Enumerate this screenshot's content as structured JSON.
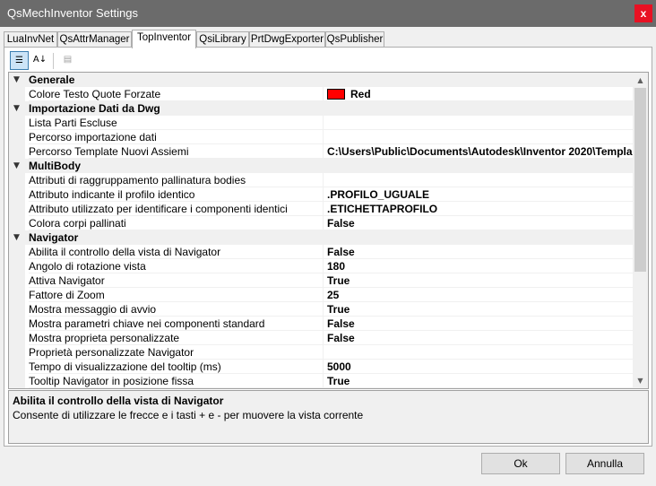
{
  "window": {
    "title": "QsMechInventor Settings",
    "close_label": "x"
  },
  "tabs": [
    {
      "label": "LuaInvNet"
    },
    {
      "label": "QsAttrManager"
    },
    {
      "label": "TopInventor"
    },
    {
      "label": "QsiLibrary"
    },
    {
      "label": "PrtDwgExporter"
    },
    {
      "label": "QsPublisher"
    }
  ],
  "active_tab": "TopInventor",
  "toolbar": {
    "categorized_icon": "categorized-icon",
    "alphabetical_icon": "alphabetical-icon",
    "property_pages_icon": "property-pages-icon"
  },
  "grid": {
    "categories": [
      {
        "label": "Generale",
        "rows": [
          {
            "name": "Colore Testo Quote Forzate",
            "value": "Red",
            "swatch_color": "#ff0000"
          }
        ]
      },
      {
        "label": "Importazione Dati da Dwg",
        "rows": [
          {
            "name": "Lista Parti Escluse",
            "value": ""
          },
          {
            "name": "Percorso importazione dati",
            "value": ""
          },
          {
            "name": "Percorso Template Nuovi Assiemi",
            "value": "C:\\Users\\Public\\Documents\\Autodesk\\Inventor 2020\\Templa"
          }
        ]
      },
      {
        "label": "MultiBody",
        "rows": [
          {
            "name": "Attributi di raggruppamento pallinatura bodies",
            "value": ""
          },
          {
            "name": "Attributo indicante il profilo identico",
            "value": ".PROFILO_UGUALE"
          },
          {
            "name": "Attributo utilizzato per identificare i componenti identici",
            "value": ".ETICHETTAPROFILO"
          },
          {
            "name": "Colora corpi pallinati",
            "value": "False"
          }
        ]
      },
      {
        "label": "Navigator",
        "rows": [
          {
            "name": "Abilita il controllo della vista di Navigator",
            "value": "False"
          },
          {
            "name": "Angolo di rotazione vista",
            "value": "180"
          },
          {
            "name": "Attiva Navigator",
            "value": "True"
          },
          {
            "name": "Fattore di Zoom",
            "value": "25"
          },
          {
            "name": "Mostra messaggio di avvio",
            "value": "True"
          },
          {
            "name": "Mostra parametri chiave nei componenti standard",
            "value": "False"
          },
          {
            "name": "Mostra proprieta personalizzate",
            "value": "False"
          },
          {
            "name": "Proprietà personalizzate Navigator",
            "value": ""
          },
          {
            "name": "Tempo di visualizzazione del tooltip (ms)",
            "value": "5000"
          },
          {
            "name": "Tooltip Navigator in posizione fissa",
            "value": "True"
          }
        ]
      }
    ]
  },
  "help": {
    "title": "Abilita il controllo della vista di Navigator",
    "description": "Consente di utilizzare le frecce e i tasti + e - per muovere la vista corrente"
  },
  "buttons": {
    "ok": "Ok",
    "cancel": "Annulla"
  }
}
